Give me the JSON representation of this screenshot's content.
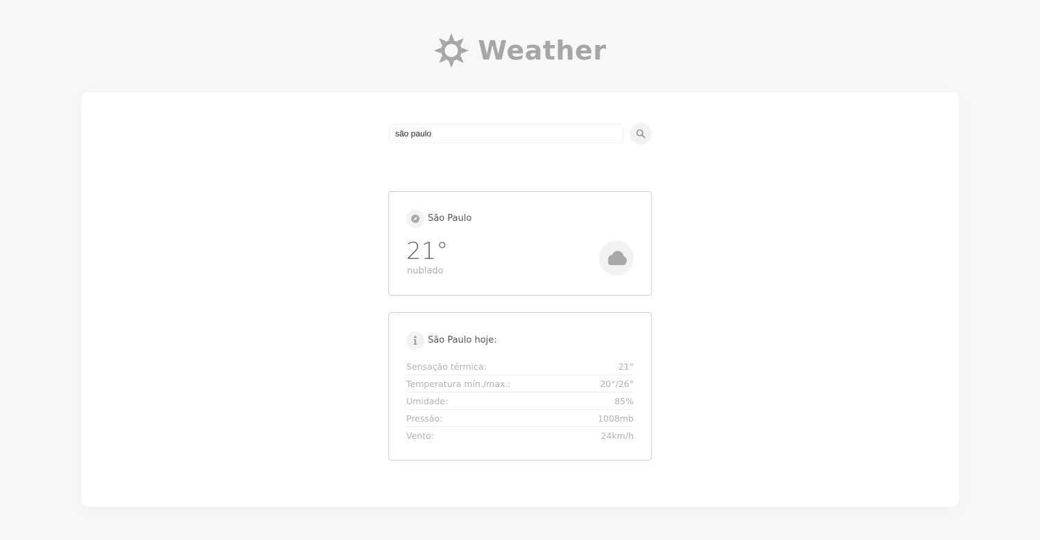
{
  "app": {
    "title": "Weather",
    "logo_icon": "sun-icon"
  },
  "search": {
    "value": "são paulo",
    "placeholder": "",
    "button_icon": "search-icon"
  },
  "current": {
    "location_icon": "compass-icon",
    "city": "São Paulo",
    "temperature": "21°",
    "description": "nublado",
    "condition_icon": "cloud-icon"
  },
  "details": {
    "info_icon": "info-icon",
    "title": "São Paulo hoje:",
    "rows": [
      {
        "label": "Sensação térmica:",
        "value": "21°"
      },
      {
        "label": "Temperatura mín./max.:",
        "value": "20°/26°"
      },
      {
        "label": "Umidade:",
        "value": "85%"
      },
      {
        "label": "Pressão:",
        "value": "1008mb"
      },
      {
        "label": "Vento:",
        "value": "24km/h"
      }
    ]
  },
  "colors": {
    "background": "#f7f7f7",
    "panel": "#ffffff",
    "logo": "#a6a6a6",
    "card_border": "#cfcfcf",
    "muted_text": "#b2b2b2"
  }
}
